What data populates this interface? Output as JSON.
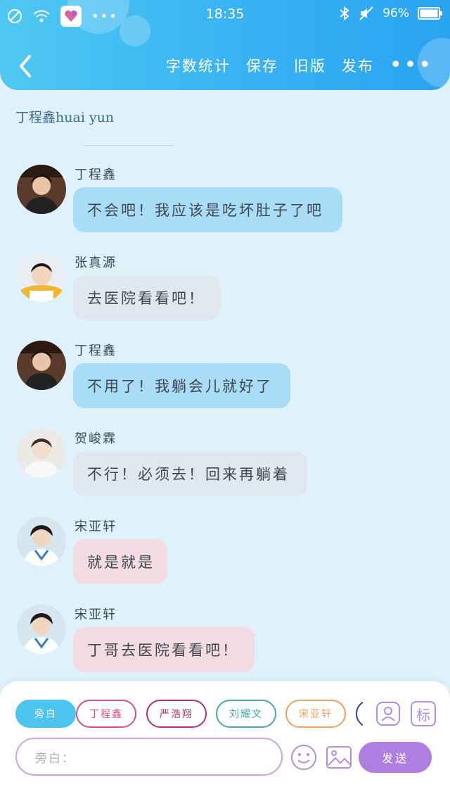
{
  "status_bar": {
    "time": "18:35",
    "battery": "96%",
    "icons": [
      "no-disturb-icon",
      "wifi-icon",
      "app-icon",
      "more-dots-icon",
      "bluetooth-icon",
      "mute-icon",
      "battery-icon"
    ]
  },
  "nav": {
    "actions": [
      "字数统计",
      "保存",
      "旧版",
      "发布"
    ],
    "more": "•••"
  },
  "story": {
    "title": "丁程鑫huai yun"
  },
  "messages": [
    {
      "name": "丁程鑫",
      "text": "不会吧！我应该是吃坏肚子了吧",
      "bubble_color": "#a9dcf7"
    },
    {
      "name": "张真源",
      "text": "去医院看看吧！",
      "bubble_color": "#e0e7ee"
    },
    {
      "name": "丁程鑫",
      "text": "不用了！我躺会儿就好了",
      "bubble_color": "#a9dcf7"
    },
    {
      "name": "贺峻霖",
      "text": "不行！必须去！回来再躺着",
      "bubble_color": "#e0e7ee"
    },
    {
      "name": "宋亚轩",
      "text": "就是就是",
      "bubble_color": "#f3dbe2"
    },
    {
      "name": "宋亚轩",
      "text": "丁哥去医院看看吧！",
      "bubble_color": "#f3dbe2"
    }
  ],
  "composer": {
    "chips": [
      {
        "label": "旁白",
        "color": "#4cc4f0",
        "filled": true
      },
      {
        "label": "丁程鑫",
        "color": "#d2508e",
        "filled": false
      },
      {
        "label": "严浩翔",
        "color": "#b0307a",
        "filled": false
      },
      {
        "label": "刘耀文",
        "color": "#49a9a8",
        "filled": false
      },
      {
        "label": "宋亚轩",
        "color": "#f0a060",
        "filled": false
      }
    ],
    "mark_label": "标",
    "placeholder": "旁白：",
    "send": "发送"
  },
  "colors": {
    "header": "#38b2f3",
    "send": "#ae7fe0"
  }
}
